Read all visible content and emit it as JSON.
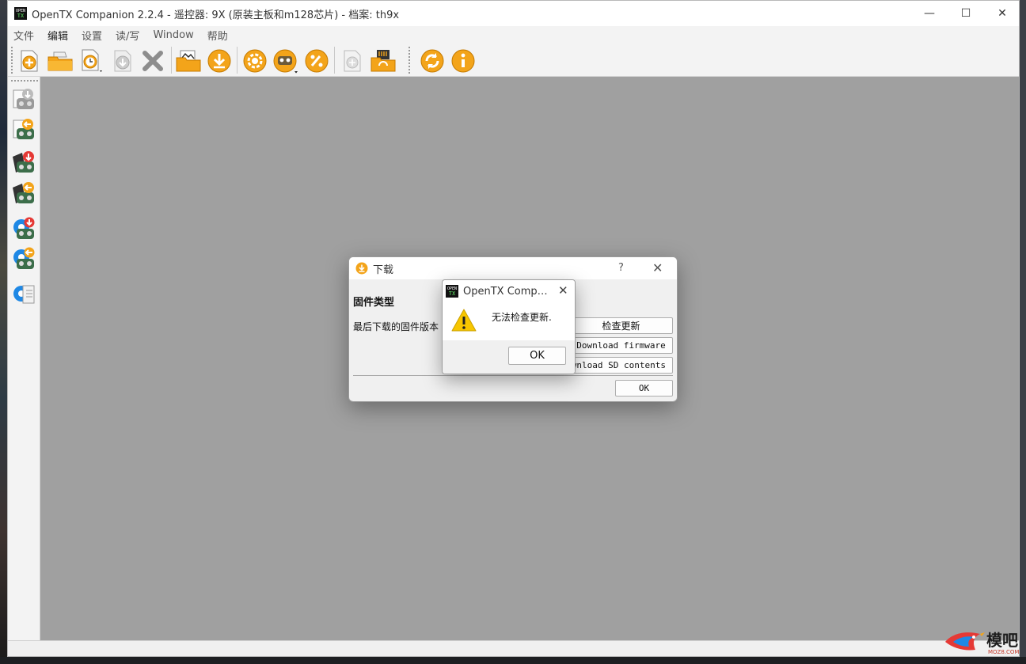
{
  "window": {
    "title": "OpenTX Companion 2.2.4 - 遥控器: 9X (原装主板和m128芯片) - 档案: th9x",
    "logo_text_top": "OPEN",
    "logo_text_bottom": "TX",
    "controls": {
      "minimize": "—",
      "maximize": "☐",
      "close": "✕"
    }
  },
  "menubar": {
    "items": [
      {
        "label": "文件"
      },
      {
        "label": "编辑"
      },
      {
        "label": "设置"
      },
      {
        "label": "读/写"
      },
      {
        "label": "Window"
      },
      {
        "label": "帮助"
      }
    ]
  },
  "toolbar": {
    "buttons": [
      {
        "icon": "new-icon"
      },
      {
        "icon": "open-icon"
      },
      {
        "icon": "recent-icon"
      },
      {
        "icon": "save-icon"
      },
      {
        "icon": "close-file-icon"
      },
      {
        "icon": "logs-icon"
      },
      {
        "icon": "download-icon"
      },
      {
        "icon": "settings-icon"
      },
      {
        "icon": "profile-icon"
      },
      {
        "icon": "customize-icon"
      },
      {
        "icon": "compare-icon"
      },
      {
        "icon": "sd-sync-icon"
      },
      {
        "icon": "update-icon"
      },
      {
        "icon": "about-icon"
      }
    ]
  },
  "sidebar": {
    "buttons": [
      {
        "icon": "read-models-icon"
      },
      {
        "icon": "write-models-icon"
      },
      {
        "icon": "read-radio-icon"
      },
      {
        "icon": "write-radio-icon"
      },
      {
        "icon": "read-firmware-icon"
      },
      {
        "icon": "write-firmware-icon"
      },
      {
        "icon": "backup-icon"
      }
    ]
  },
  "download_dialog": {
    "title": "下载",
    "help": "?",
    "close": "✕",
    "firmware_type_label": "固件类型",
    "last_version_label": "最后下载的固件版本",
    "check_update_button": "检查更新",
    "download_firmware_button": "Download firmware",
    "download_sd_button": "Download SD contents",
    "ok_button": "OK"
  },
  "message_box": {
    "title": "OpenTX Companion",
    "close": "✕",
    "message": "无法检查更新.",
    "ok_button": "OK",
    "icon": "warning-icon"
  },
  "watermark": {
    "text": "模吧",
    "sub": "MOZ8.COM"
  },
  "colors": {
    "mdi_background": "#a0a0a0",
    "accent_orange": "#f0a500",
    "warning_yellow": "#f7c600"
  }
}
